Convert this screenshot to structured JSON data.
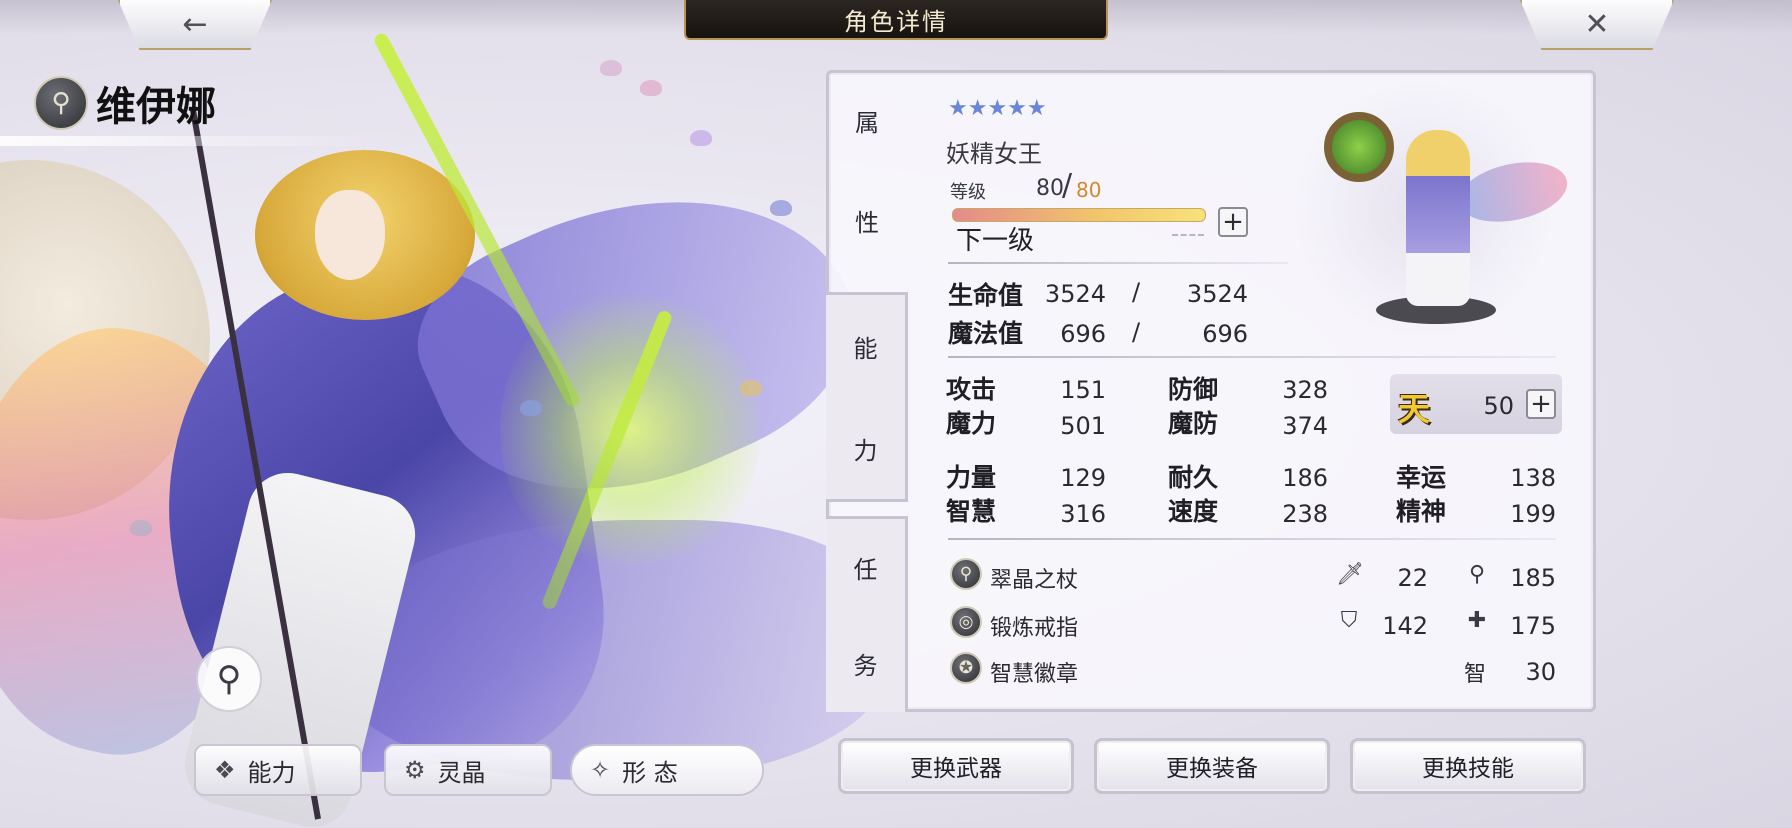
{
  "header": {
    "title": "角色详情",
    "back_icon": "←",
    "close_icon": "✕"
  },
  "character": {
    "name": "维伊娜",
    "class_icon": "⚲",
    "stars": "★★★★★",
    "title": "妖精女王",
    "level_label": "等级",
    "level_current": "80",
    "level_slash": "/",
    "level_max": "80",
    "next_level_label": "下一级",
    "level_progress": 1.0
  },
  "side_tabs": {
    "attributes": [
      "属",
      "性"
    ],
    "ability": [
      "能",
      "力"
    ],
    "mission": [
      "任",
      "务"
    ]
  },
  "vitals": [
    {
      "label": "生命值",
      "current": "3524",
      "slash": "/",
      "max": "3524"
    },
    {
      "label": "魔法值",
      "current": "696",
      "slash": "/",
      "max": "696"
    }
  ],
  "stats": {
    "attack_label": "攻击",
    "attack": "151",
    "defense_label": "防御",
    "defense": "328",
    "magic_label": "魔力",
    "magic": "501",
    "mdef_label": "魔防",
    "mdef": "374",
    "strength_label": "力量",
    "strength": "129",
    "endurance_label": "耐久",
    "endurance": "186",
    "luck_label": "幸运",
    "luck": "138",
    "wisdom_label": "智慧",
    "wisdom": "316",
    "speed_label": "速度",
    "speed": "238",
    "spirit_label": "精神",
    "spirit": "199"
  },
  "gift": {
    "glyph": "天",
    "value": "50",
    "plus": "+"
  },
  "equipment": [
    {
      "icon": "⚲",
      "name": "翠晶之杖",
      "stat1_icon": "sword-icon",
      "stat1": "22",
      "stat2_icon": "staff-icon",
      "stat2": "185"
    },
    {
      "icon": "◎",
      "name": "锻炼戒指",
      "stat1_icon": "shield-icon",
      "stat1": "142",
      "stat2_icon": "cross-shield-icon",
      "stat2": "175"
    },
    {
      "icon": "✪",
      "name": "智慧徽章",
      "stat2_label": "智",
      "stat2": "30"
    }
  ],
  "bottom_tabs": {
    "ability": "能力",
    "crystal": "灵晶",
    "form": "形 态"
  },
  "actions": {
    "change_weapon": "更换武器",
    "change_equipment": "更换装备",
    "change_skill": "更换技能"
  },
  "colors": {
    "accent_gold": "#b8954e",
    "level_max": "#d28a2a",
    "star": "#6a86d8"
  }
}
